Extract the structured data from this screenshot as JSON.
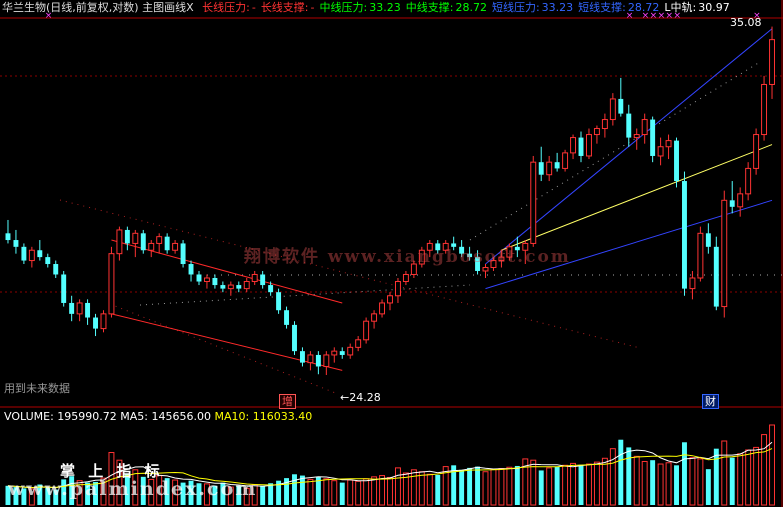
{
  "header": {
    "title": "华兰生物(日线,前复权,对数) 主图画线X",
    "items": [
      {
        "label": "长线压力:",
        "value": "-",
        "color": "#ff3333"
      },
      {
        "label": "长线支撑:",
        "value": "-",
        "color": "#ff3333"
      },
      {
        "label": "中线压力:",
        "value": "33.23",
        "color": "#00ff00"
      },
      {
        "label": "中线支撑:",
        "value": "28.72",
        "color": "#00ff00"
      },
      {
        "label": "短线压力:",
        "value": "33.23",
        "color": "#3366ff"
      },
      {
        "label": "短线支撑:",
        "value": "28.72",
        "color": "#3366ff"
      },
      {
        "label": "L中轨:",
        "value": "30.97",
        "color": "#ffffff"
      }
    ]
  },
  "price_panel": {
    "high_label": "35.08",
    "low_label": "←24.28",
    "future_data_text": "用到未来数据",
    "event_markers": [
      {
        "text": "增",
        "color": "#ff4444"
      },
      {
        "text": "财",
        "color": "#3366ff"
      }
    ],
    "watermark": "翔博软件 www.xiangbosoft.com"
  },
  "volume_panel": {
    "title": "VOLUME:",
    "value": "195990.72",
    "ma5_label": "MA5:",
    "ma5_value": "145656.00",
    "ma10_label": "MA10:",
    "ma10_value": "116033.40",
    "watermark_top": "掌 上 指 标",
    "watermark_bottom": "www.palmindex.com"
  },
  "colors": {
    "up": "#ff3333",
    "down": "#54ffff",
    "background": "#000000",
    "grid": "#8b0000",
    "ma5": "#ffffff",
    "ma10": "#ffff00"
  },
  "chart_data": {
    "type": "candlestick",
    "candles": [
      [
        28.2,
        28.6,
        27.9,
        28.0
      ],
      [
        28.0,
        28.3,
        27.6,
        27.8
      ],
      [
        27.8,
        27.9,
        27.3,
        27.4
      ],
      [
        27.4,
        27.8,
        27.2,
        27.7
      ],
      [
        27.7,
        28.0,
        27.4,
        27.5
      ],
      [
        27.5,
        27.6,
        27.2,
        27.3
      ],
      [
        27.3,
        27.4,
        26.9,
        27.0
      ],
      [
        27.0,
        27.1,
        26.1,
        26.2
      ],
      [
        26.2,
        26.4,
        25.7,
        25.9
      ],
      [
        25.9,
        26.3,
        25.7,
        26.2
      ],
      [
        26.2,
        26.3,
        25.6,
        25.8
      ],
      [
        25.8,
        25.9,
        25.3,
        25.5
      ],
      [
        25.5,
        26.0,
        25.4,
        25.9
      ],
      [
        25.9,
        27.8,
        25.8,
        27.6
      ],
      [
        27.6,
        28.4,
        27.4,
        28.3
      ],
      [
        28.3,
        28.4,
        27.7,
        27.9
      ],
      [
        27.9,
        28.3,
        27.5,
        28.2
      ],
      [
        28.2,
        28.3,
        27.6,
        27.7
      ],
      [
        27.7,
        28.0,
        27.5,
        27.9
      ],
      [
        27.9,
        28.2,
        27.6,
        28.1
      ],
      [
        28.1,
        28.2,
        27.6,
        27.7
      ],
      [
        27.7,
        28.0,
        27.6,
        27.9
      ],
      [
        27.9,
        28.0,
        27.2,
        27.3
      ],
      [
        27.3,
        27.4,
        26.8,
        27.0
      ],
      [
        27.0,
        27.1,
        26.7,
        26.8
      ],
      [
        26.8,
        27.0,
        26.6,
        26.9
      ],
      [
        26.9,
        27.0,
        26.6,
        26.7
      ],
      [
        26.7,
        26.8,
        26.5,
        26.6
      ],
      [
        26.6,
        26.8,
        26.4,
        26.7
      ],
      [
        26.7,
        26.8,
        26.5,
        26.6
      ],
      [
        26.6,
        26.9,
        26.5,
        26.8
      ],
      [
        26.8,
        27.1,
        26.7,
        27.0
      ],
      [
        27.0,
        27.1,
        26.6,
        26.7
      ],
      [
        26.7,
        26.8,
        26.4,
        26.5
      ],
      [
        26.5,
        26.6,
        25.9,
        26.0
      ],
      [
        26.0,
        26.1,
        25.5,
        25.6
      ],
      [
        25.6,
        25.7,
        24.8,
        24.9
      ],
      [
        24.9,
        25.0,
        24.5,
        24.6
      ],
      [
        24.6,
        24.9,
        24.4,
        24.8
      ],
      [
        24.8,
        24.9,
        24.3,
        24.5
      ],
      [
        24.5,
        24.9,
        24.28,
        24.8
      ],
      [
        24.8,
        25.0,
        24.6,
        24.9
      ],
      [
        24.9,
        25.0,
        24.7,
        24.8
      ],
      [
        24.8,
        25.1,
        24.7,
        25.0
      ],
      [
        25.0,
        25.3,
        24.9,
        25.2
      ],
      [
        25.2,
        25.8,
        25.1,
        25.7
      ],
      [
        25.7,
        26.0,
        25.5,
        25.9
      ],
      [
        25.9,
        26.3,
        25.8,
        26.2
      ],
      [
        26.2,
        26.5,
        26.0,
        26.4
      ],
      [
        26.4,
        26.9,
        26.2,
        26.8
      ],
      [
        26.8,
        27.1,
        26.7,
        27.0
      ],
      [
        27.0,
        27.4,
        26.9,
        27.3
      ],
      [
        27.3,
        27.8,
        27.2,
        27.7
      ],
      [
        27.7,
        28.0,
        27.5,
        27.9
      ],
      [
        27.9,
        28.0,
        27.6,
        27.7
      ],
      [
        27.7,
        28.0,
        27.6,
        27.9
      ],
      [
        27.9,
        28.1,
        27.7,
        27.8
      ],
      [
        27.8,
        28.0,
        27.5,
        27.6
      ],
      [
        27.6,
        27.8,
        27.4,
        27.5
      ],
      [
        27.5,
        27.7,
        27.0,
        27.1
      ],
      [
        27.1,
        27.3,
        26.9,
        27.2
      ],
      [
        27.2,
        27.5,
        27.1,
        27.4
      ],
      [
        27.4,
        27.7,
        27.2,
        27.5
      ],
      [
        27.5,
        27.9,
        27.4,
        27.8
      ],
      [
        27.8,
        28.1,
        27.5,
        27.7
      ],
      [
        27.7,
        28.0,
        27.3,
        27.9
      ],
      [
        27.9,
        30.6,
        27.8,
        30.4
      ],
      [
        30.4,
        30.9,
        29.8,
        30.0
      ],
      [
        30.0,
        30.6,
        29.8,
        30.4
      ],
      [
        30.4,
        30.7,
        30.1,
        30.2
      ],
      [
        30.2,
        30.8,
        30.1,
        30.7
      ],
      [
        30.7,
        31.3,
        30.5,
        31.2
      ],
      [
        31.2,
        31.4,
        30.4,
        30.6
      ],
      [
        30.6,
        31.5,
        30.5,
        31.3
      ],
      [
        31.3,
        31.6,
        31.0,
        31.5
      ],
      [
        31.5,
        32.0,
        31.2,
        31.8
      ],
      [
        31.8,
        32.7,
        31.6,
        32.5
      ],
      [
        32.5,
        33.23,
        31.9,
        32.0
      ],
      [
        32.0,
        32.3,
        30.9,
        31.2
      ],
      [
        31.2,
        31.5,
        30.8,
        31.3
      ],
      [
        31.3,
        32.0,
        31.0,
        31.8
      ],
      [
        31.8,
        31.9,
        30.4,
        30.6
      ],
      [
        30.6,
        31.2,
        30.3,
        30.9
      ],
      [
        30.9,
        31.3,
        30.5,
        31.1
      ],
      [
        31.1,
        31.2,
        29.6,
        29.8
      ],
      [
        29.8,
        30.1,
        26.4,
        26.6
      ],
      [
        26.6,
        27.1,
        26.3,
        26.9
      ],
      [
        26.9,
        28.4,
        26.8,
        28.2
      ],
      [
        28.2,
        28.5,
        27.6,
        27.8
      ],
      [
        27.8,
        28.1,
        26.0,
        26.1
      ],
      [
        26.1,
        29.5,
        25.8,
        29.2
      ],
      [
        29.2,
        29.8,
        28.8,
        29.0
      ],
      [
        29.0,
        29.6,
        28.7,
        29.4
      ],
      [
        29.4,
        30.4,
        29.2,
        30.2
      ],
      [
        30.2,
        31.5,
        30.0,
        31.3
      ],
      [
        31.3,
        33.3,
        31.1,
        33.0
      ],
      [
        33.0,
        35.08,
        32.5,
        34.6
      ]
    ],
    "volumes": [
      30,
      28,
      26,
      25,
      32,
      27,
      24,
      40,
      45,
      38,
      35,
      36,
      42,
      82,
      70,
      48,
      55,
      44,
      40,
      46,
      42,
      39,
      35,
      38,
      34,
      33,
      30,
      35,
      28,
      30,
      26,
      32,
      30,
      34,
      38,
      42,
      48,
      46,
      40,
      44,
      41,
      38,
      35,
      39,
      37,
      41,
      44,
      46,
      43,
      58,
      50,
      55,
      52,
      48,
      47,
      60,
      62,
      55,
      58,
      60,
      52,
      56,
      57,
      59,
      61,
      72,
      70,
      54,
      58,
      60,
      62,
      65,
      63,
      64,
      67,
      73,
      88,
      102,
      90,
      76,
      68,
      70,
      64,
      66,
      62,
      98,
      74,
      72,
      56,
      88,
      100,
      74,
      80,
      86,
      90,
      110,
      125
    ],
    "volume_labels": {
      "volume": 195990.72,
      "ma5": 145656.0,
      "ma10": 116033.4
    },
    "lines": [
      {
        "name": "长线压力",
        "values": [
          28.0,
          26.2
        ]
      },
      {
        "name": "长线支撑",
        "values": [
          25.9,
          24.4
        ]
      },
      {
        "name": "中线压力",
        "values": [
          27.3,
          35.0
        ]
      },
      {
        "name": "中线支撑",
        "values": [
          26.6,
          29.2
        ]
      },
      {
        "name": "短线压力",
        "values": [
          28.1,
          34.6
        ]
      },
      {
        "name": "短线支撑",
        "values": [
          26.8,
          28.5
        ]
      },
      {
        "name": "L中轨",
        "values": [
          27.7,
          30.97
        ]
      }
    ],
    "ylim": [
      24.0,
      35.4
    ],
    "y_scale": "log"
  }
}
